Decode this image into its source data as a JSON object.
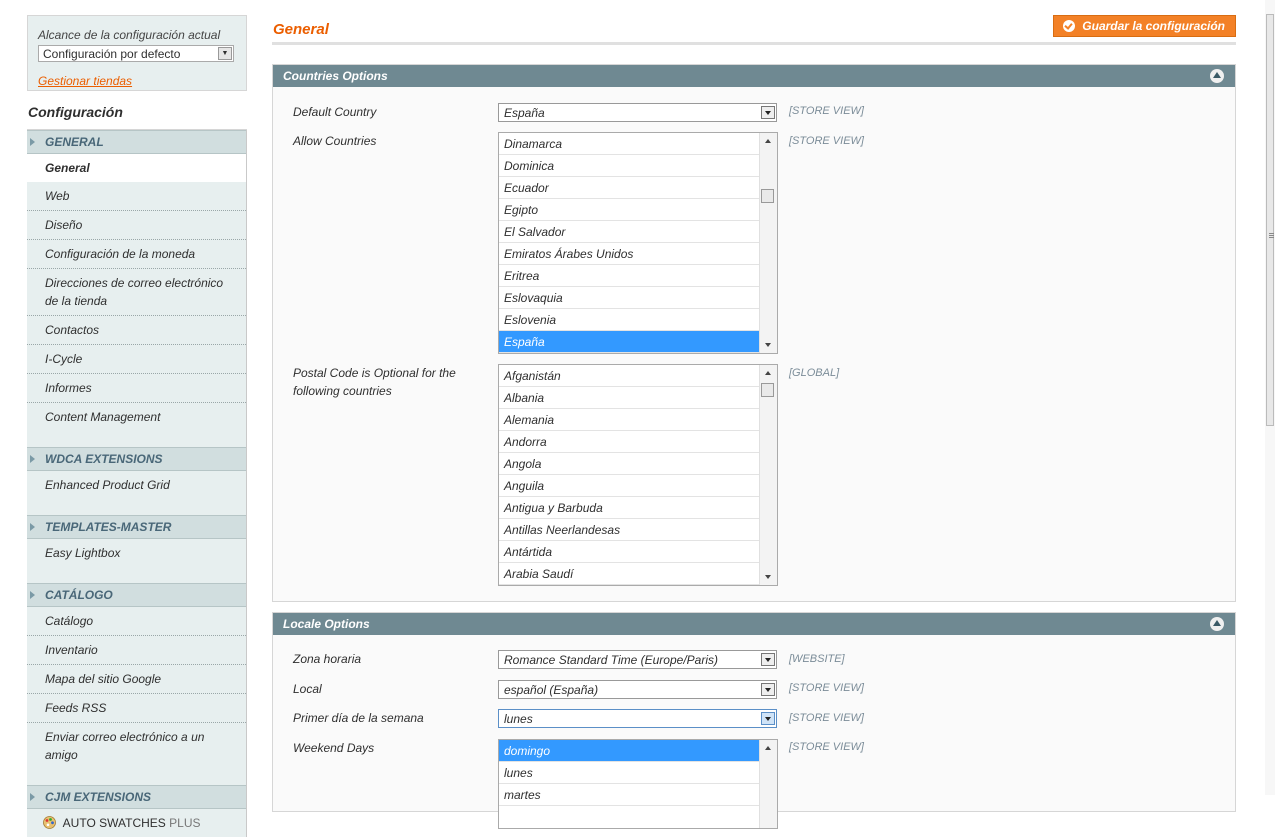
{
  "scope": {
    "label": "Alcance de la configuración actual",
    "selected": "Configuración por defecto",
    "manage_link": "Gestionar tiendas"
  },
  "sidebar": {
    "title": "Configuración",
    "groups": [
      {
        "name": "GENERAL",
        "items": [
          "General",
          "Web",
          "Diseño",
          "Configuración de la moneda",
          "Direcciones de correo electrónico de la tienda",
          "Contactos",
          "I-Cycle",
          "Informes",
          "Content Management"
        ]
      },
      {
        "name": "WDCA EXTENSIONS",
        "items": [
          "Enhanced Product Grid"
        ]
      },
      {
        "name": "TEMPLATES-MASTER",
        "items": [
          "Easy Lightbox"
        ]
      },
      {
        "name": "CATÁLOGO",
        "items": [
          "Catálogo",
          "Inventario",
          "Mapa del sitio Google",
          "Feeds RSS",
          "Enviar correo electrónico a un amigo"
        ]
      },
      {
        "name": "CJM EXTENSIONS",
        "items": [
          "AUTO SWATCHES",
          "PLUS"
        ]
      }
    ]
  },
  "page": {
    "title": "General",
    "save_button": "Guardar la configuración"
  },
  "countries": {
    "header": "Countries Options",
    "default_country": {
      "label": "Default Country",
      "value": "España",
      "scope": "[STORE VIEW]"
    },
    "allow_countries": {
      "label": "Allow Countries",
      "scope": "[STORE VIEW]",
      "options": [
        "Dinamarca",
        "Dominica",
        "Ecuador",
        "Egipto",
        "El Salvador",
        "Emiratos Árabes Unidos",
        "Eritrea",
        "Eslovaquia",
        "Eslovenia",
        "España"
      ],
      "selected": "España"
    },
    "postal_optional": {
      "label": "Postal Code is Optional for the following countries",
      "scope": "[GLOBAL]",
      "options": [
        "Afganistán",
        "Albania",
        "Alemania",
        "Andorra",
        "Angola",
        "Anguila",
        "Antigua y Barbuda",
        "Antillas Neerlandesas",
        "Antártida",
        "Arabia Saudí"
      ]
    }
  },
  "locale": {
    "header": "Locale Options",
    "timezone": {
      "label": "Zona horaria",
      "value": "Romance Standard Time (Europe/Paris)",
      "scope": "[WEBSITE]"
    },
    "locale": {
      "label": "Local",
      "value": "español (España)",
      "scope": "[STORE VIEW]"
    },
    "first_day": {
      "label": "Primer día de la semana",
      "value": "lunes",
      "scope": "[STORE VIEW]"
    },
    "weekend": {
      "label": "Weekend Days",
      "scope": "[STORE VIEW]",
      "options": [
        "domingo",
        "lunes",
        "martes"
      ],
      "selected": "domingo"
    }
  },
  "colors": {
    "accent": "#eb5e00",
    "button": "#f38127",
    "section_header": "#6f8992",
    "selection": "#3399ff"
  }
}
